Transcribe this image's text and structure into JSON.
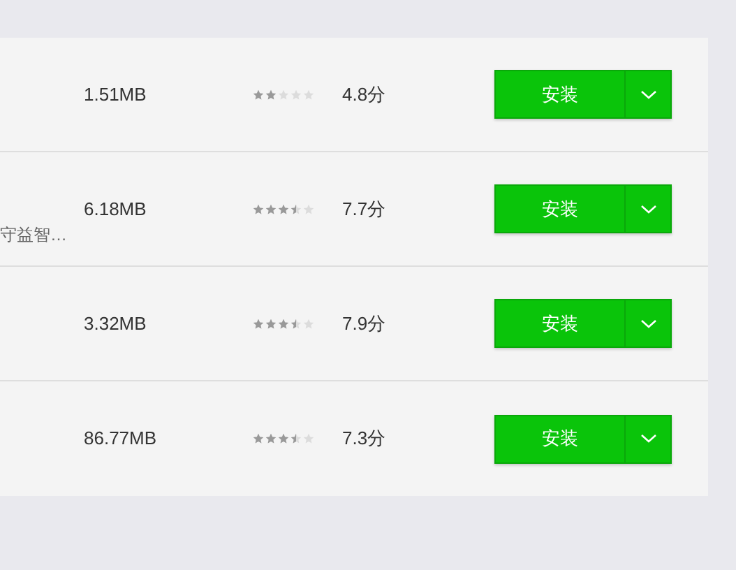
{
  "apps": [
    {
      "size": "1.51MB",
      "stars": 2,
      "score": "4.8分",
      "install": "安装"
    },
    {
      "description": "守益智…",
      "size": "6.18MB",
      "stars": 3.5,
      "score": "7.7分",
      "install": "安装"
    },
    {
      "size": "3.32MB",
      "stars": 3.5,
      "score": "7.9分",
      "install": "安装"
    },
    {
      "size": "86.77MB",
      "stars": 3.5,
      "score": "7.3分",
      "install": "安装"
    }
  ]
}
